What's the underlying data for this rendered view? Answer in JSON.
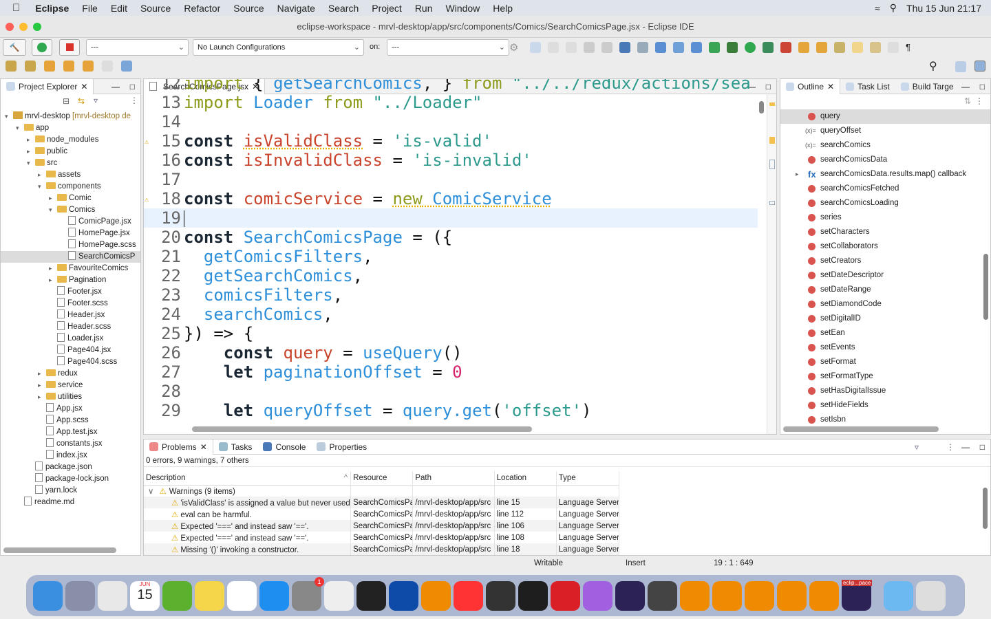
{
  "menubar": {
    "app": "Eclipse",
    "items": [
      "File",
      "Edit",
      "Source",
      "Refactor",
      "Source",
      "Navigate",
      "Search",
      "Project",
      "Run",
      "Window",
      "Help"
    ],
    "clock": "Thu 15 Jun  21:17"
  },
  "window": {
    "title": "eclipse-workspace - mrvl-desktop/app/src/components/Comics/SearchComicsPage.jsx - Eclipse IDE"
  },
  "toolbar": {
    "run_config": "---",
    "launch_config": "No Launch Configurations",
    "on_label": "on:",
    "target": "---"
  },
  "project_explorer": {
    "title": "Project Explorer",
    "items": [
      {
        "label": "mrvl-desktop",
        "suffix": " [mrvl-desktop de",
        "depth": 0,
        "type": "project",
        "open": true
      },
      {
        "label": "app",
        "depth": 1,
        "type": "folder",
        "open": true
      },
      {
        "label": "node_modules",
        "depth": 2,
        "type": "folder",
        "open": false
      },
      {
        "label": "public",
        "depth": 2,
        "type": "folder",
        "open": false
      },
      {
        "label": "src",
        "depth": 2,
        "type": "folder",
        "open": true
      },
      {
        "label": "assets",
        "depth": 3,
        "type": "folder",
        "open": false
      },
      {
        "label": "components",
        "depth": 3,
        "type": "folder",
        "open": true
      },
      {
        "label": "Comic",
        "depth": 4,
        "type": "folder",
        "open": false
      },
      {
        "label": "Comics",
        "depth": 4,
        "type": "folder",
        "open": true
      },
      {
        "label": "ComicPage.jsx",
        "depth": 5,
        "type": "file"
      },
      {
        "label": "HomePage.jsx",
        "depth": 5,
        "type": "file"
      },
      {
        "label": "HomePage.scss",
        "depth": 5,
        "type": "file"
      },
      {
        "label": "SearchComicsP",
        "depth": 5,
        "type": "file",
        "selected": true
      },
      {
        "label": "FavouriteComics",
        "depth": 4,
        "type": "folder",
        "open": false
      },
      {
        "label": "Pagination",
        "depth": 4,
        "type": "folder",
        "open": false
      },
      {
        "label": "Footer.jsx",
        "depth": 4,
        "type": "file"
      },
      {
        "label": "Footer.scss",
        "depth": 4,
        "type": "file"
      },
      {
        "label": "Header.jsx",
        "depth": 4,
        "type": "file"
      },
      {
        "label": "Header.scss",
        "depth": 4,
        "type": "file"
      },
      {
        "label": "Loader.jsx",
        "depth": 4,
        "type": "file"
      },
      {
        "label": "Page404.jsx",
        "depth": 4,
        "type": "file"
      },
      {
        "label": "Page404.scss",
        "depth": 4,
        "type": "file"
      },
      {
        "label": "redux",
        "depth": 3,
        "type": "folder",
        "open": false
      },
      {
        "label": "service",
        "depth": 3,
        "type": "folder",
        "open": false
      },
      {
        "label": "utilities",
        "depth": 3,
        "type": "folder",
        "open": false
      },
      {
        "label": "App.jsx",
        "depth": 3,
        "type": "file"
      },
      {
        "label": "App.scss",
        "depth": 3,
        "type": "file"
      },
      {
        "label": "App.test.jsx",
        "depth": 3,
        "type": "file"
      },
      {
        "label": "constants.jsx",
        "depth": 3,
        "type": "file"
      },
      {
        "label": "index.jsx",
        "depth": 3,
        "type": "file"
      },
      {
        "label": "package.json",
        "depth": 2,
        "type": "file"
      },
      {
        "label": "package-lock.json",
        "depth": 2,
        "type": "file"
      },
      {
        "label": "yarn.lock",
        "depth": 2,
        "type": "file"
      },
      {
        "label": "readme.md",
        "depth": 1,
        "type": "file"
      }
    ]
  },
  "editor": {
    "tab": "SearchComicsPage.jsx",
    "lines": [
      {
        "n": "12",
        "parts": [
          [
            "im",
            "import"
          ],
          [
            "p",
            " { "
          ],
          [
            "f",
            "getSearchComics"
          ],
          [
            "p",
            ", } "
          ],
          [
            "im",
            "from"
          ],
          [
            "s",
            " \"../../redux/actions/sea"
          ]
        ]
      },
      {
        "n": "13",
        "parts": [
          [
            "im",
            "import"
          ],
          [
            "p",
            " "
          ],
          [
            "f",
            "Loader"
          ],
          [
            "p",
            " "
          ],
          [
            "im",
            "from"
          ],
          [
            "s",
            " \"../Loader\""
          ]
        ]
      },
      {
        "n": "14",
        "parts": []
      },
      {
        "n": "15",
        "warn": true,
        "parts": [
          [
            "k",
            "const"
          ],
          [
            "p",
            " "
          ],
          [
            "v und",
            "isValidClass"
          ],
          [
            "p",
            " = "
          ],
          [
            "s",
            "'is-valid'"
          ]
        ]
      },
      {
        "n": "16",
        "parts": [
          [
            "k",
            "const"
          ],
          [
            "p",
            " "
          ],
          [
            "v",
            "isInvalidClass"
          ],
          [
            "p",
            " = "
          ],
          [
            "s",
            "'is-invalid'"
          ]
        ]
      },
      {
        "n": "17",
        "parts": []
      },
      {
        "n": "18",
        "warn": true,
        "parts": [
          [
            "k",
            "const"
          ],
          [
            "p",
            " "
          ],
          [
            "v",
            "comicService"
          ],
          [
            "p",
            " = "
          ],
          [
            "im und",
            "new"
          ],
          [
            "f und",
            " ComicService"
          ]
        ]
      },
      {
        "n": "19",
        "current": true,
        "parts": []
      },
      {
        "n": "20",
        "parts": [
          [
            "k",
            "const"
          ],
          [
            "p",
            " "
          ],
          [
            "f",
            "SearchComicsPage"
          ],
          [
            "p",
            " = ({"
          ]
        ]
      },
      {
        "n": "21",
        "parts": [
          [
            "p",
            "  "
          ],
          [
            "f",
            "getComicsFilters"
          ],
          [
            "p",
            ","
          ]
        ]
      },
      {
        "n": "22",
        "parts": [
          [
            "p",
            "  "
          ],
          [
            "f",
            "getSearchComics"
          ],
          [
            "p",
            ","
          ]
        ]
      },
      {
        "n": "23",
        "parts": [
          [
            "p",
            "  "
          ],
          [
            "f",
            "comicsFilters"
          ],
          [
            "p",
            ","
          ]
        ]
      },
      {
        "n": "24",
        "parts": [
          [
            "p",
            "  "
          ],
          [
            "f",
            "searchComics"
          ],
          [
            "p",
            ","
          ]
        ]
      },
      {
        "n": "25",
        "parts": [
          [
            "p",
            "}) => {"
          ]
        ]
      },
      {
        "n": "26",
        "parts": [
          [
            "p",
            "    "
          ],
          [
            "k",
            "const"
          ],
          [
            "p",
            " "
          ],
          [
            "v",
            "query"
          ],
          [
            "p",
            " = "
          ],
          [
            "f",
            "useQuery"
          ],
          [
            "p",
            "()"
          ]
        ]
      },
      {
        "n": "27",
        "parts": [
          [
            "p",
            "    "
          ],
          [
            "k",
            "let"
          ],
          [
            "p",
            " "
          ],
          [
            "f",
            "paginationOffset"
          ],
          [
            "p",
            " = "
          ],
          [
            "n",
            "0"
          ]
        ]
      },
      {
        "n": "28",
        "parts": []
      },
      {
        "n": "29",
        "parts": [
          [
            "p",
            "    "
          ],
          [
            "k",
            "let"
          ],
          [
            "p",
            " "
          ],
          [
            "f",
            "queryOffset"
          ],
          [
            "p",
            " = "
          ],
          [
            "f",
            "query.get"
          ],
          [
            "p",
            "("
          ],
          [
            "s",
            "'offset'"
          ],
          [
            "p",
            ")"
          ]
        ]
      }
    ]
  },
  "outline": {
    "tabs": [
      "Outline",
      "Task List",
      "Build Targe"
    ],
    "items": [
      {
        "label": "query",
        "kind": "func",
        "selected": true
      },
      {
        "label": "queryOffset",
        "kind": "var"
      },
      {
        "label": "searchComics",
        "kind": "var"
      },
      {
        "label": "searchComicsData",
        "kind": "func"
      },
      {
        "label": "searchComicsData.results.map() callback",
        "kind": "fx",
        "expandable": true
      },
      {
        "label": "searchComicsFetched",
        "kind": "func"
      },
      {
        "label": "searchComicsLoading",
        "kind": "func"
      },
      {
        "label": "series",
        "kind": "func"
      },
      {
        "label": "setCharacters",
        "kind": "func"
      },
      {
        "label": "setCollaborators",
        "kind": "func"
      },
      {
        "label": "setCreators",
        "kind": "func"
      },
      {
        "label": "setDateDescriptor",
        "kind": "func"
      },
      {
        "label": "setDateRange",
        "kind": "func"
      },
      {
        "label": "setDiamondCode",
        "kind": "func"
      },
      {
        "label": "setDigitalID",
        "kind": "func"
      },
      {
        "label": "setEan",
        "kind": "func"
      },
      {
        "label": "setEvents",
        "kind": "func"
      },
      {
        "label": "setFormat",
        "kind": "func"
      },
      {
        "label": "setFormatType",
        "kind": "func"
      },
      {
        "label": "setHasDigitalIssue",
        "kind": "func"
      },
      {
        "label": "setHideFields",
        "kind": "func"
      },
      {
        "label": "setIsbn",
        "kind": "func"
      }
    ]
  },
  "problems": {
    "tabs": [
      "Problems",
      "Tasks",
      "Console",
      "Properties"
    ],
    "summary": "0 errors, 9 warnings, 7 others",
    "columns": [
      "Description",
      "Resource",
      "Path",
      "Location",
      "Type"
    ],
    "group": "Warnings (9 items)",
    "rows": [
      [
        "'isValidClass' is assigned a value but never used",
        "SearchComicsPa",
        "/mrvl-desktop/app/src",
        "line 15",
        "Language Server"
      ],
      [
        "eval can be harmful.",
        "SearchComicsPa",
        "/mrvl-desktop/app/src",
        "line 112",
        "Language Server"
      ],
      [
        "Expected '===' and instead saw '=='.",
        "SearchComicsPa",
        "/mrvl-desktop/app/src",
        "line 106",
        "Language Server"
      ],
      [
        "Expected '===' and instead saw '=='.",
        "SearchComicsPa",
        "/mrvl-desktop/app/src",
        "line 108",
        "Language Server"
      ],
      [
        "Missing '()' invoking a constructor.",
        "SearchComicsPa",
        "/mrvl-desktop/app/src",
        "line 18",
        "Language Server"
      ]
    ]
  },
  "status": {
    "mode": "Writable",
    "insert": "Insert",
    "position": "19 : 1 : 649"
  },
  "dock": {
    "calendar_month": "JUN",
    "calendar_day": "15",
    "settings_badge": "1",
    "eclipse_label": "eclip...pace",
    "apps": [
      [
        "finder",
        "#3b8fe0"
      ],
      [
        "launchpad",
        "#8a8fa8"
      ],
      [
        "chrome",
        "#e8e8e8"
      ],
      [
        "calendar",
        "#fff"
      ],
      [
        "utorrent",
        "#5bb02e"
      ],
      [
        "notes",
        "#f5d54a"
      ],
      [
        "reminders",
        "#fff"
      ],
      [
        "app-store",
        "#1f8ef1"
      ],
      [
        "system-settings",
        "#888"
      ],
      [
        "textedit",
        "#eee"
      ],
      [
        "terminal",
        "#222"
      ],
      [
        "teamviewer",
        "#0e4aa8"
      ],
      [
        "vlc",
        "#f08a00"
      ],
      [
        "news",
        "#f33"
      ],
      [
        "nox",
        "#333"
      ],
      [
        "voice-memos",
        "#1e1e1e"
      ],
      [
        "creative-cloud",
        "#da1f26"
      ],
      [
        "flower",
        "#a060e0"
      ],
      [
        "eclipse",
        "#2c2255"
      ],
      [
        "electron",
        "#444"
      ],
      [
        "vlc-2",
        "#f08a00"
      ],
      [
        "vlc-3",
        "#f08a00"
      ],
      [
        "vlc-4",
        "#f08a00"
      ],
      [
        "vlc-5",
        "#f08a00"
      ],
      [
        "vlc-6",
        "#f08a00"
      ],
      [
        "eclipse-workspace",
        "#2c2255"
      ],
      [
        "downloads-folder",
        "#6cb8f0"
      ],
      [
        "trash",
        "#ddd"
      ]
    ]
  }
}
